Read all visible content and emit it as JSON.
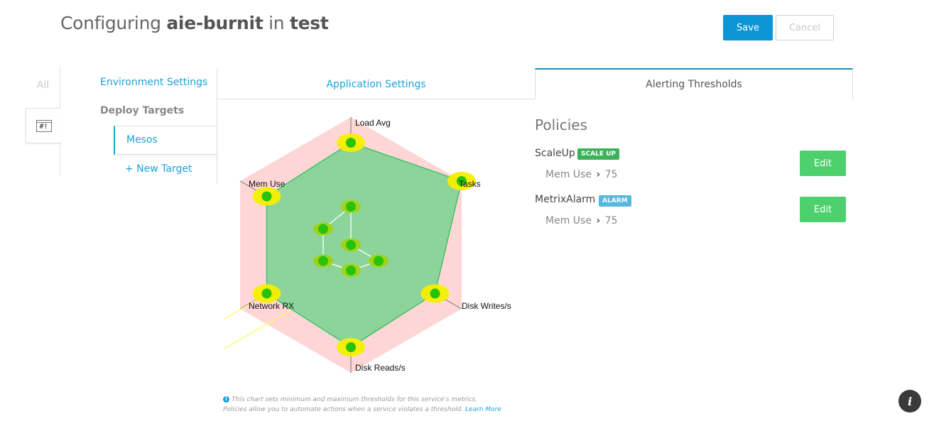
{
  "header": {
    "prefix": "Configuring",
    "service": "aie-burnit",
    "conjunction": "in",
    "environment": "test",
    "save_label": "Save",
    "cancel_label": "Cancel"
  },
  "side_tabs": {
    "all_label": "All",
    "hashbang_label": "#!"
  },
  "nav": {
    "environment_settings": "Environment Settings",
    "deploy_targets": "Deploy Targets",
    "selected_target": "Mesos",
    "new_target": "+ New Target"
  },
  "tabs": [
    {
      "label": "Application Settings",
      "active": false
    },
    {
      "label": "Alerting Thresholds",
      "active": true
    }
  ],
  "chart_data": {
    "type": "radar",
    "axes": [
      "Load Avg",
      "Tasks",
      "Disk Writes/s",
      "Disk Reads/s",
      "Network RX",
      "Mem Use"
    ],
    "max_thresholds": [
      0.8,
      1.0,
      0.76,
      0.8,
      0.76,
      0.76
    ],
    "min_thresholds": [
      0.3,
      0.0,
      0.25,
      0.2,
      0.25,
      0.25
    ],
    "colors": {
      "bounds": "#ffd6d6",
      "area_fill": "#8cd49a",
      "area_stroke": "#2fbf5f",
      "handle": "#28c20a",
      "handle_highlight": "#f6ef00",
      "axis": "#8a8a8a"
    }
  },
  "chart_note": {
    "info_icon": "i",
    "line1": "This chart sets minimum and maximum thresholds for this service's metrics.",
    "line2": "Policies allow you to automate actions when a service violates a threshold.",
    "learn_more": "Learn More"
  },
  "policies": {
    "title": "Policies",
    "items": [
      {
        "name": "ScaleUp",
        "badge": "SCALE UP",
        "metric": "Mem Use",
        "comparator_icon": "chevron-right",
        "comparator_glyph": "›",
        "value": "75",
        "edit_label": "Edit"
      },
      {
        "name": "MetrixAlarm",
        "badge": "ALARM",
        "metric": "Mem Use",
        "comparator_icon": "chevron-right",
        "comparator_glyph": "›",
        "value": "75",
        "edit_label": "Edit"
      }
    ]
  },
  "info_button": "i"
}
